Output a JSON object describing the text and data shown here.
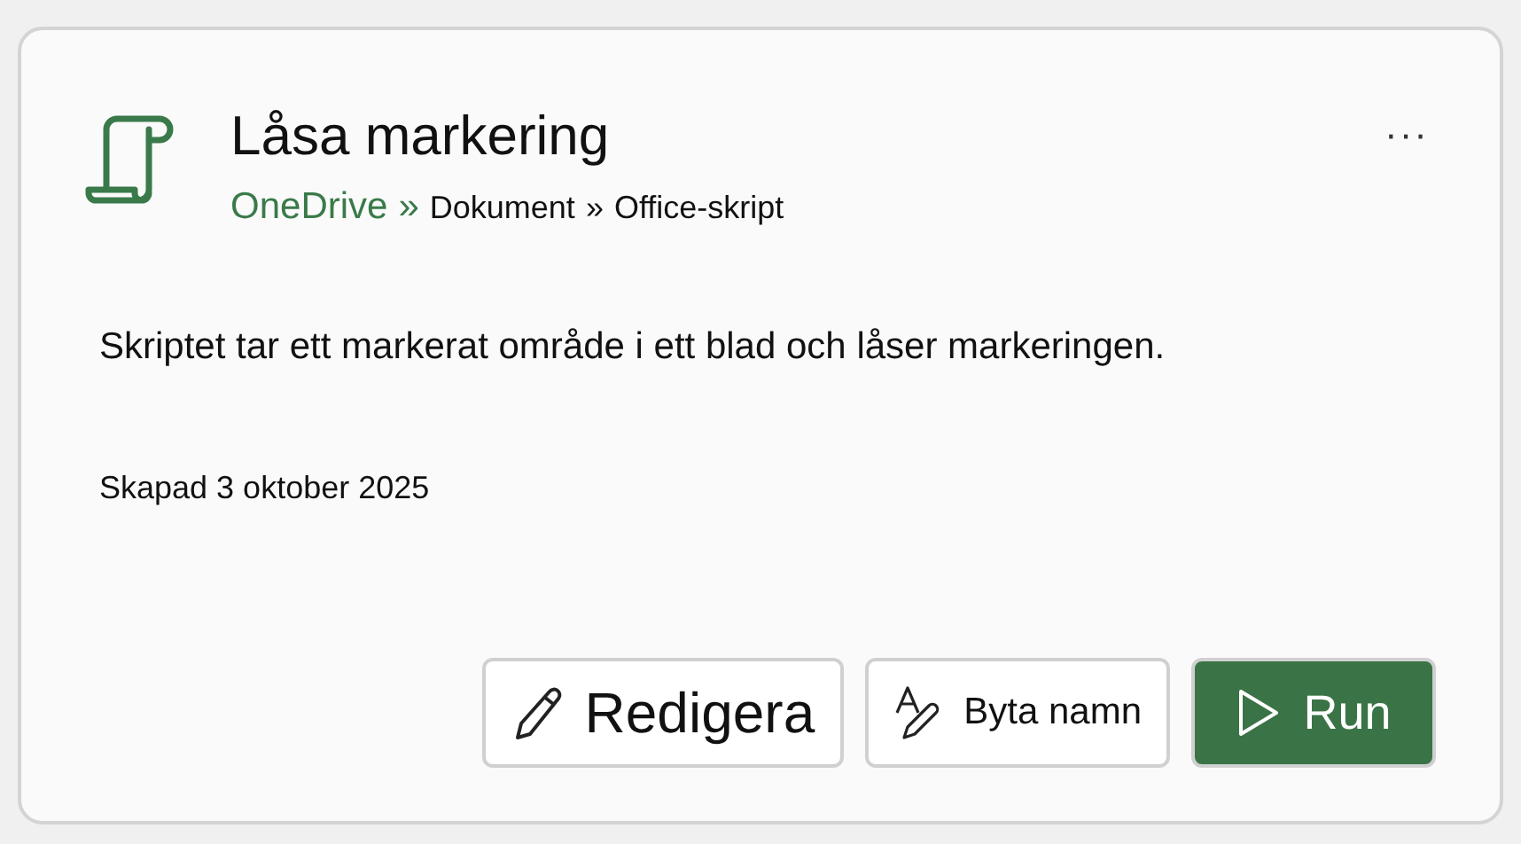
{
  "card": {
    "title": "Låsa markering",
    "more": "···",
    "breadcrumb": [
      {
        "label": "OneDrive",
        "kind": "link"
      },
      {
        "label": "»",
        "kind": "sep-link"
      },
      {
        "label": "Dokument",
        "kind": "text"
      },
      {
        "label": "»",
        "kind": "sep"
      },
      {
        "label": "Office-skript",
        "kind": "text"
      }
    ],
    "description": "Skriptet tar ett markerat område i ett blad och låser markeringen.",
    "created": "Skapad 3 oktober 2025",
    "buttons": [
      {
        "label": "Redigera",
        "kind": "edit"
      },
      {
        "label": "Byta namn",
        "kind": "rename"
      },
      {
        "label": "Run",
        "kind": "run"
      }
    ]
  }
}
